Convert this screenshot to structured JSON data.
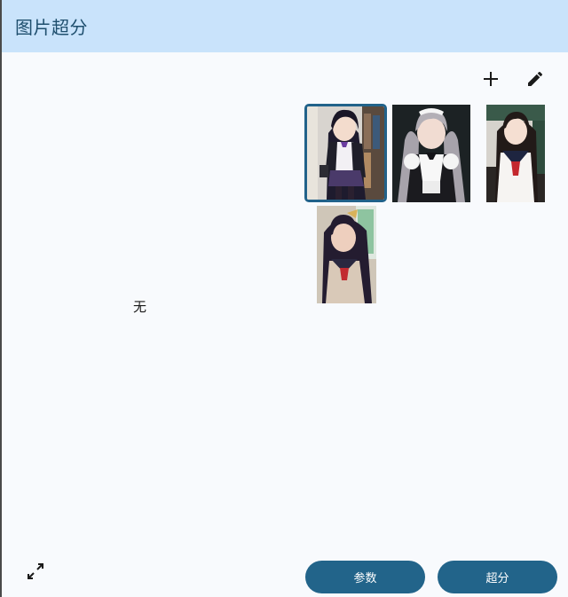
{
  "header": {
    "title": "图片超分"
  },
  "toolbar": {
    "add_icon": "plus-icon",
    "edit_icon": "pencil-icon"
  },
  "preview": {
    "empty_text": "无"
  },
  "gallery": {
    "items": [
      {
        "icon": "anime-girl-blazer-thumbnail",
        "selected": true
      },
      {
        "icon": "anime-girl-maid-thumbnail",
        "selected": false
      },
      {
        "icon": "anime-girl-sailor-uniform-thumbnail",
        "selected": false
      },
      {
        "icon": "anime-girl-dark-hair-thumbnail",
        "selected": false
      }
    ]
  },
  "footer": {
    "expand_icon": "expand-icon",
    "params_label": "参数",
    "upscale_label": "超分"
  },
  "colors": {
    "header_bg": "#c9e3fb",
    "title_text": "#1f4f6e",
    "accent": "#22648a",
    "background": "#f8fafd"
  }
}
